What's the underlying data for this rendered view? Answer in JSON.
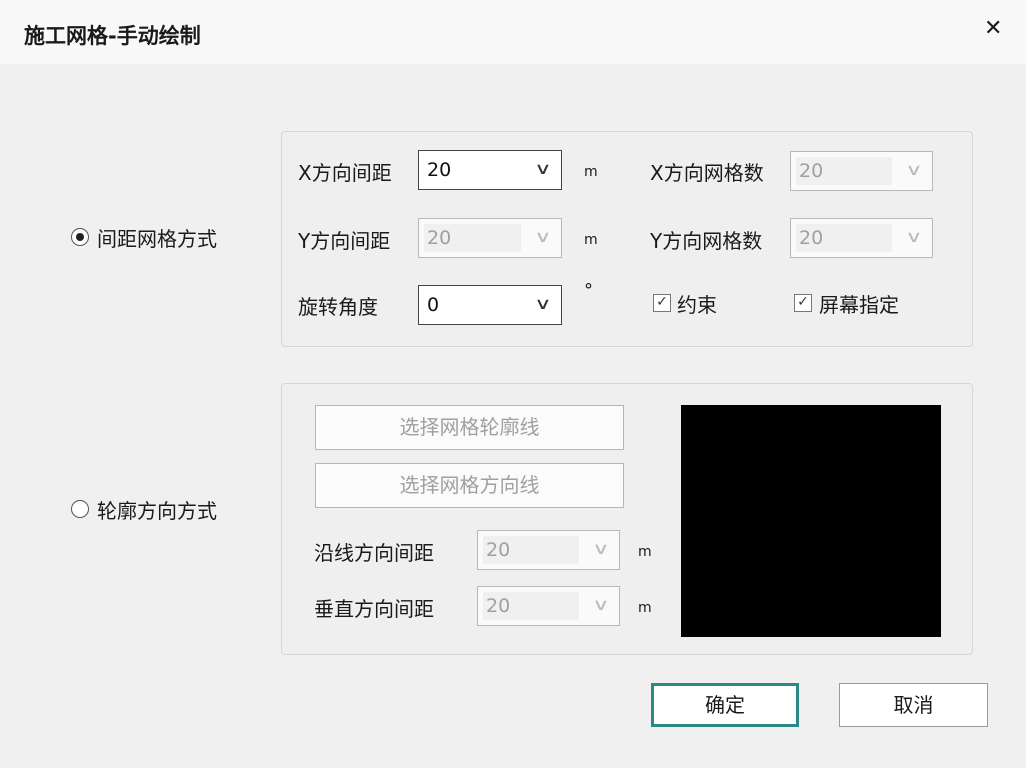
{
  "title": "施工网格-手动绘制",
  "close_icon": "close-icon",
  "mode1": {
    "label": "间距网格方式",
    "selected": true
  },
  "mode2": {
    "label": "轮廓方向方式",
    "selected": false
  },
  "x_spacing": {
    "label": "X方向间距",
    "value": "20",
    "unit": "m"
  },
  "y_spacing": {
    "label": "Y方向间距",
    "value": "20",
    "unit": "m"
  },
  "rotation": {
    "label": "旋转角度",
    "value": "0",
    "unit": "°"
  },
  "x_count": {
    "label": "X方向网格数",
    "value": "20"
  },
  "y_count": {
    "label": "Y方向网格数",
    "value": "20"
  },
  "constraint": {
    "label": "约束",
    "checked": true
  },
  "screen_specify": {
    "label": "屏幕指定",
    "checked": true
  },
  "select_outline": "选择网格轮廓线",
  "select_direction": "选择网格方向线",
  "along_spacing": {
    "label": "沿线方向间距",
    "value": "20",
    "unit": "m"
  },
  "vertical_spacing": {
    "label": "垂直方向间距",
    "value": "20",
    "unit": "m"
  },
  "ok": "确定",
  "cancel": "取消",
  "check_glyph": "✓",
  "chevron": "∨"
}
